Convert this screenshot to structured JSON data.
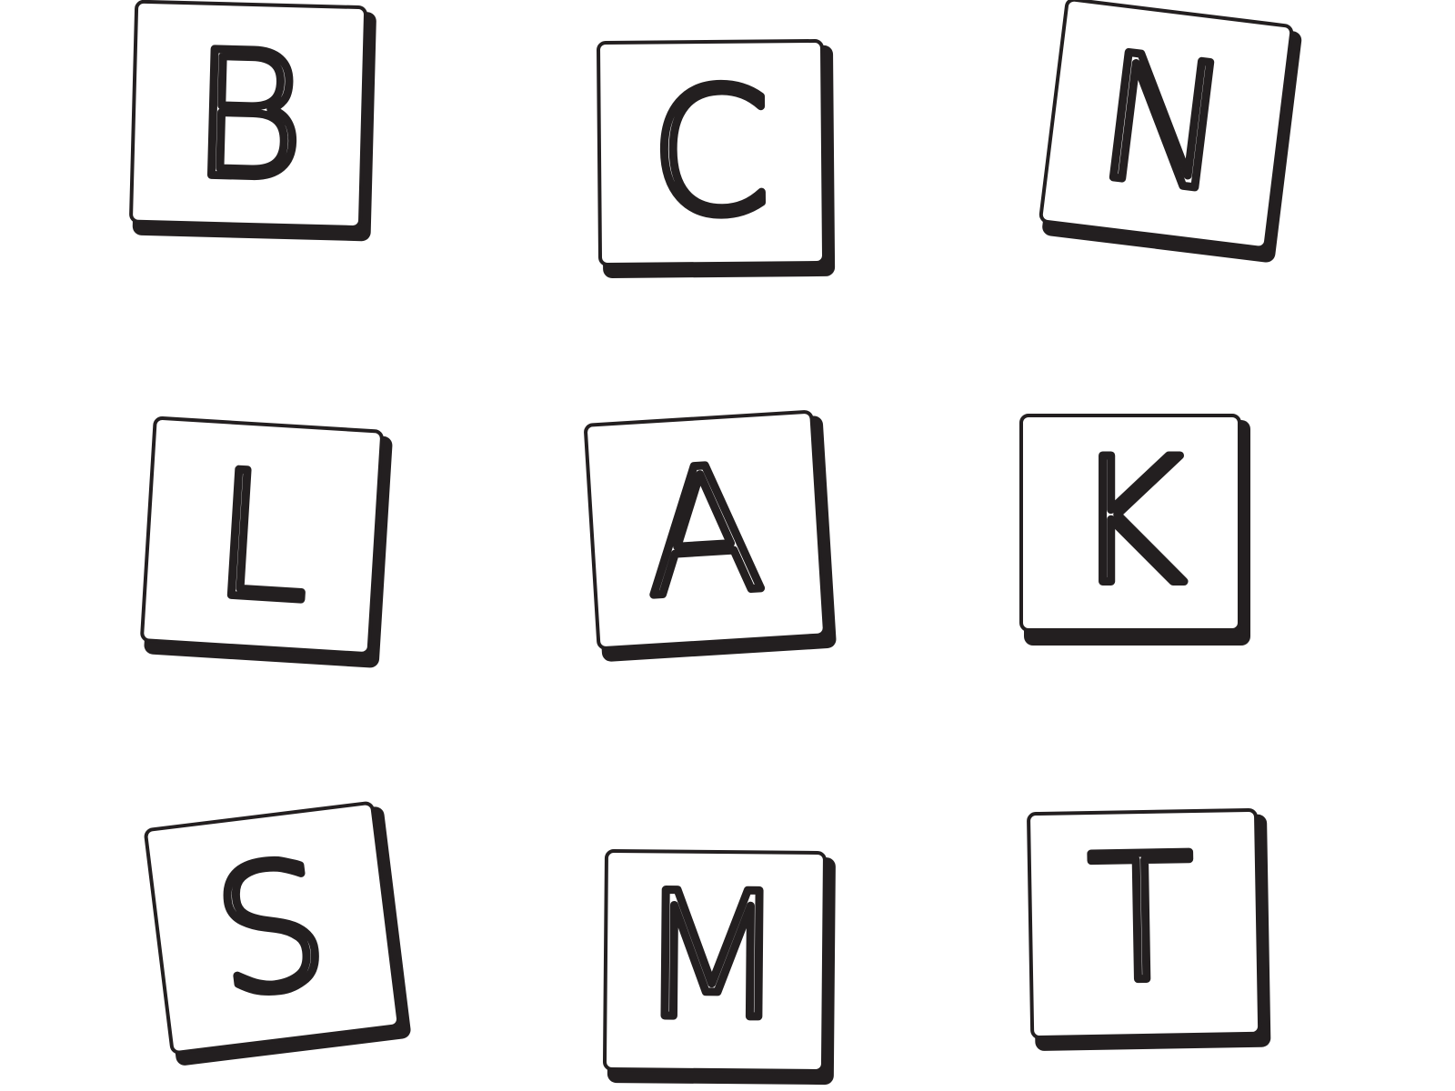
{
  "blocks": [
    {
      "letter": "B",
      "row": 1,
      "col": 1
    },
    {
      "letter": "C",
      "row": 1,
      "col": 2
    },
    {
      "letter": "N",
      "row": 1,
      "col": 3
    },
    {
      "letter": "L",
      "row": 2,
      "col": 1
    },
    {
      "letter": "A",
      "row": 2,
      "col": 2
    },
    {
      "letter": "K",
      "row": 2,
      "col": 3
    },
    {
      "letter": "S",
      "row": 3,
      "col": 1
    },
    {
      "letter": "M",
      "row": 3,
      "col": 2
    },
    {
      "letter": "T",
      "row": 3,
      "col": 3
    }
  ],
  "colors": {
    "ink": "#231f20",
    "paper": "#ffffff"
  }
}
